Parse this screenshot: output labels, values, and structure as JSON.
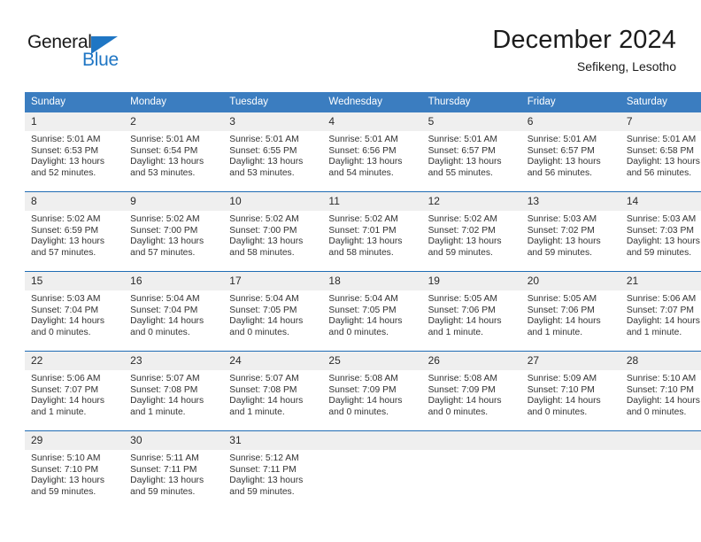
{
  "branding": {
    "logo_text_primary": "General",
    "logo_text_secondary": "Blue",
    "logo_primary_color": "#1a1a1a",
    "logo_accent_color": "#1f76c4"
  },
  "header": {
    "month_title": "December 2024",
    "location": "Sefikeng, Lesotho"
  },
  "theme": {
    "header_band_color": "#3b7dc0",
    "week_separator_color": "#1f6cb4",
    "daynum_band_color": "#efefef",
    "body_background": "#ffffff",
    "text_color": "#333333"
  },
  "calendar": {
    "day_headers": [
      "Sunday",
      "Monday",
      "Tuesday",
      "Wednesday",
      "Thursday",
      "Friday",
      "Saturday"
    ],
    "weeks": [
      {
        "days": [
          {
            "num": "1",
            "sunrise": "Sunrise: 5:01 AM",
            "sunset": "Sunset: 6:53 PM",
            "daylight_1": "Daylight: 13 hours",
            "daylight_2": "and 52 minutes."
          },
          {
            "num": "2",
            "sunrise": "Sunrise: 5:01 AM",
            "sunset": "Sunset: 6:54 PM",
            "daylight_1": "Daylight: 13 hours",
            "daylight_2": "and 53 minutes."
          },
          {
            "num": "3",
            "sunrise": "Sunrise: 5:01 AM",
            "sunset": "Sunset: 6:55 PM",
            "daylight_1": "Daylight: 13 hours",
            "daylight_2": "and 53 minutes."
          },
          {
            "num": "4",
            "sunrise": "Sunrise: 5:01 AM",
            "sunset": "Sunset: 6:56 PM",
            "daylight_1": "Daylight: 13 hours",
            "daylight_2": "and 54 minutes."
          },
          {
            "num": "5",
            "sunrise": "Sunrise: 5:01 AM",
            "sunset": "Sunset: 6:57 PM",
            "daylight_1": "Daylight: 13 hours",
            "daylight_2": "and 55 minutes."
          },
          {
            "num": "6",
            "sunrise": "Sunrise: 5:01 AM",
            "sunset": "Sunset: 6:57 PM",
            "daylight_1": "Daylight: 13 hours",
            "daylight_2": "and 56 minutes."
          },
          {
            "num": "7",
            "sunrise": "Sunrise: 5:01 AM",
            "sunset": "Sunset: 6:58 PM",
            "daylight_1": "Daylight: 13 hours",
            "daylight_2": "and 56 minutes."
          }
        ]
      },
      {
        "days": [
          {
            "num": "8",
            "sunrise": "Sunrise: 5:02 AM",
            "sunset": "Sunset: 6:59 PM",
            "daylight_1": "Daylight: 13 hours",
            "daylight_2": "and 57 minutes."
          },
          {
            "num": "9",
            "sunrise": "Sunrise: 5:02 AM",
            "sunset": "Sunset: 7:00 PM",
            "daylight_1": "Daylight: 13 hours",
            "daylight_2": "and 57 minutes."
          },
          {
            "num": "10",
            "sunrise": "Sunrise: 5:02 AM",
            "sunset": "Sunset: 7:00 PM",
            "daylight_1": "Daylight: 13 hours",
            "daylight_2": "and 58 minutes."
          },
          {
            "num": "11",
            "sunrise": "Sunrise: 5:02 AM",
            "sunset": "Sunset: 7:01 PM",
            "daylight_1": "Daylight: 13 hours",
            "daylight_2": "and 58 minutes."
          },
          {
            "num": "12",
            "sunrise": "Sunrise: 5:02 AM",
            "sunset": "Sunset: 7:02 PM",
            "daylight_1": "Daylight: 13 hours",
            "daylight_2": "and 59 minutes."
          },
          {
            "num": "13",
            "sunrise": "Sunrise: 5:03 AM",
            "sunset": "Sunset: 7:02 PM",
            "daylight_1": "Daylight: 13 hours",
            "daylight_2": "and 59 minutes."
          },
          {
            "num": "14",
            "sunrise": "Sunrise: 5:03 AM",
            "sunset": "Sunset: 7:03 PM",
            "daylight_1": "Daylight: 13 hours",
            "daylight_2": "and 59 minutes."
          }
        ]
      },
      {
        "days": [
          {
            "num": "15",
            "sunrise": "Sunrise: 5:03 AM",
            "sunset": "Sunset: 7:04 PM",
            "daylight_1": "Daylight: 14 hours",
            "daylight_2": "and 0 minutes."
          },
          {
            "num": "16",
            "sunrise": "Sunrise: 5:04 AM",
            "sunset": "Sunset: 7:04 PM",
            "daylight_1": "Daylight: 14 hours",
            "daylight_2": "and 0 minutes."
          },
          {
            "num": "17",
            "sunrise": "Sunrise: 5:04 AM",
            "sunset": "Sunset: 7:05 PM",
            "daylight_1": "Daylight: 14 hours",
            "daylight_2": "and 0 minutes."
          },
          {
            "num": "18",
            "sunrise": "Sunrise: 5:04 AM",
            "sunset": "Sunset: 7:05 PM",
            "daylight_1": "Daylight: 14 hours",
            "daylight_2": "and 0 minutes."
          },
          {
            "num": "19",
            "sunrise": "Sunrise: 5:05 AM",
            "sunset": "Sunset: 7:06 PM",
            "daylight_1": "Daylight: 14 hours",
            "daylight_2": "and 1 minute."
          },
          {
            "num": "20",
            "sunrise": "Sunrise: 5:05 AM",
            "sunset": "Sunset: 7:06 PM",
            "daylight_1": "Daylight: 14 hours",
            "daylight_2": "and 1 minute."
          },
          {
            "num": "21",
            "sunrise": "Sunrise: 5:06 AM",
            "sunset": "Sunset: 7:07 PM",
            "daylight_1": "Daylight: 14 hours",
            "daylight_2": "and 1 minute."
          }
        ]
      },
      {
        "days": [
          {
            "num": "22",
            "sunrise": "Sunrise: 5:06 AM",
            "sunset": "Sunset: 7:07 PM",
            "daylight_1": "Daylight: 14 hours",
            "daylight_2": "and 1 minute."
          },
          {
            "num": "23",
            "sunrise": "Sunrise: 5:07 AM",
            "sunset": "Sunset: 7:08 PM",
            "daylight_1": "Daylight: 14 hours",
            "daylight_2": "and 1 minute."
          },
          {
            "num": "24",
            "sunrise": "Sunrise: 5:07 AM",
            "sunset": "Sunset: 7:08 PM",
            "daylight_1": "Daylight: 14 hours",
            "daylight_2": "and 1 minute."
          },
          {
            "num": "25",
            "sunrise": "Sunrise: 5:08 AM",
            "sunset": "Sunset: 7:09 PM",
            "daylight_1": "Daylight: 14 hours",
            "daylight_2": "and 0 minutes."
          },
          {
            "num": "26",
            "sunrise": "Sunrise: 5:08 AM",
            "sunset": "Sunset: 7:09 PM",
            "daylight_1": "Daylight: 14 hours",
            "daylight_2": "and 0 minutes."
          },
          {
            "num": "27",
            "sunrise": "Sunrise: 5:09 AM",
            "sunset": "Sunset: 7:10 PM",
            "daylight_1": "Daylight: 14 hours",
            "daylight_2": "and 0 minutes."
          },
          {
            "num": "28",
            "sunrise": "Sunrise: 5:10 AM",
            "sunset": "Sunset: 7:10 PM",
            "daylight_1": "Daylight: 14 hours",
            "daylight_2": "and 0 minutes."
          }
        ]
      },
      {
        "days": [
          {
            "num": "29",
            "sunrise": "Sunrise: 5:10 AM",
            "sunset": "Sunset: 7:10 PM",
            "daylight_1": "Daylight: 13 hours",
            "daylight_2": "and 59 minutes."
          },
          {
            "num": "30",
            "sunrise": "Sunrise: 5:11 AM",
            "sunset": "Sunset: 7:11 PM",
            "daylight_1": "Daylight: 13 hours",
            "daylight_2": "and 59 minutes."
          },
          {
            "num": "31",
            "sunrise": "Sunrise: 5:12 AM",
            "sunset": "Sunset: 7:11 PM",
            "daylight_1": "Daylight: 13 hours",
            "daylight_2": "and 59 minutes."
          },
          {
            "num": "",
            "sunrise": "",
            "sunset": "",
            "daylight_1": "",
            "daylight_2": ""
          },
          {
            "num": "",
            "sunrise": "",
            "sunset": "",
            "daylight_1": "",
            "daylight_2": ""
          },
          {
            "num": "",
            "sunrise": "",
            "sunset": "",
            "daylight_1": "",
            "daylight_2": ""
          },
          {
            "num": "",
            "sunrise": "",
            "sunset": "",
            "daylight_1": "",
            "daylight_2": ""
          }
        ]
      }
    ]
  }
}
